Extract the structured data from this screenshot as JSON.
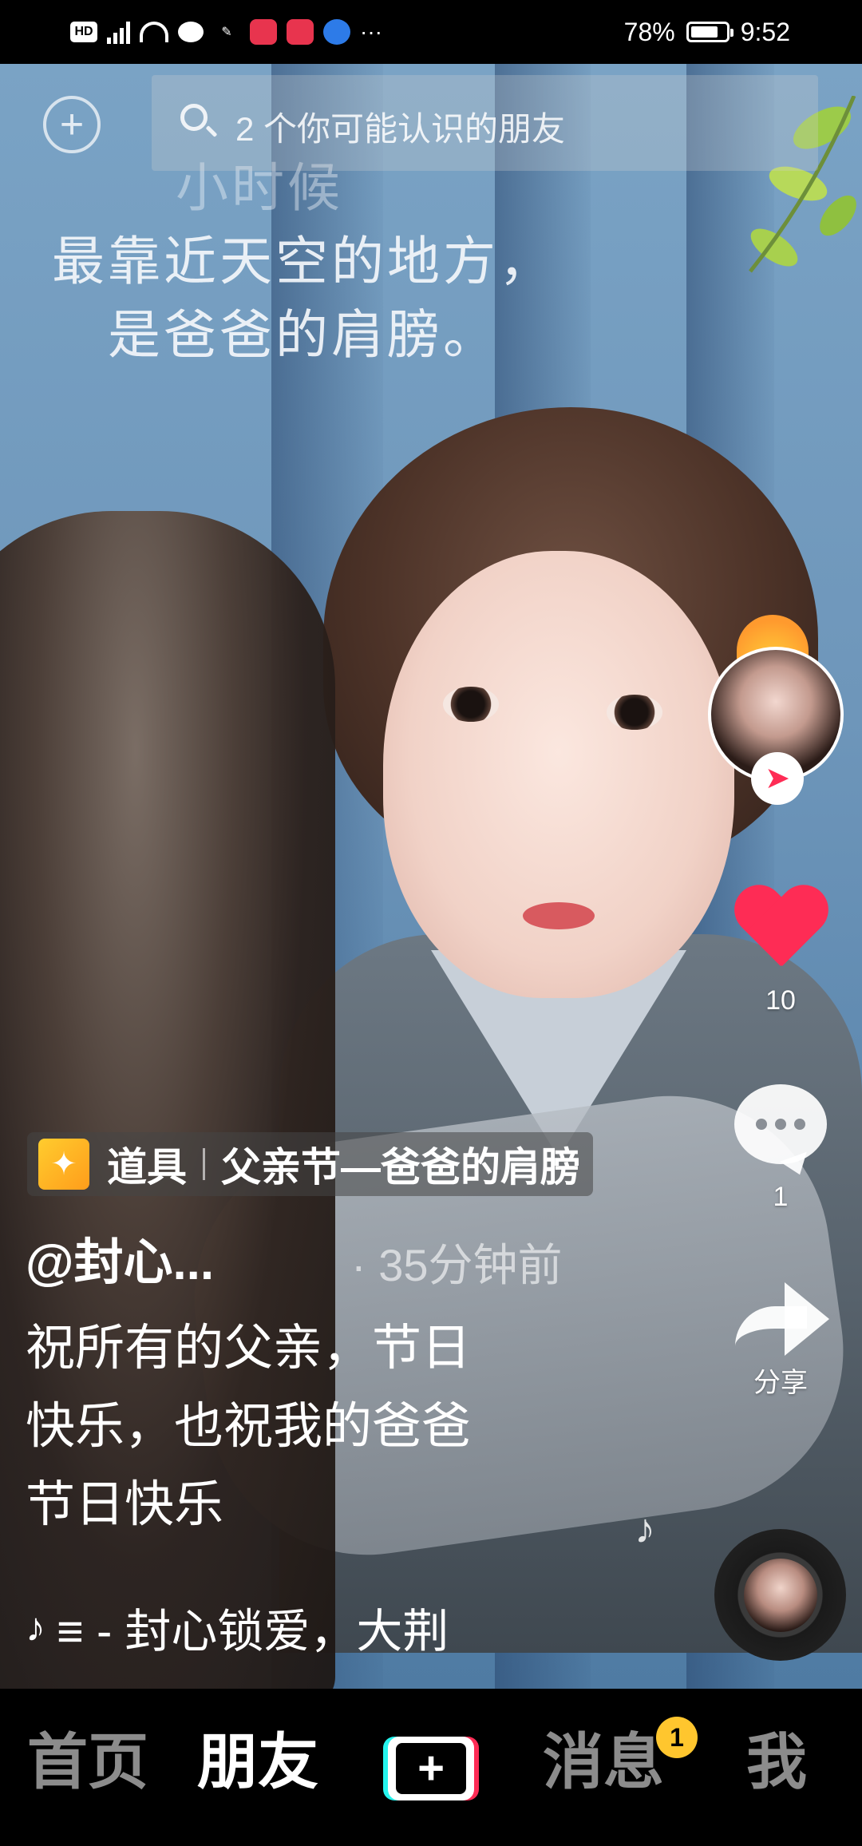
{
  "status_bar": {
    "left_icons": [
      "hd-icon",
      "4g-signal-icon",
      "wifi-icon",
      "wechat-icon",
      "app-icon",
      "huawei-app-icon",
      "huawei-icon",
      "browser-icon"
    ],
    "more": "···",
    "battery": "78%",
    "battery_level": 0.78,
    "time": "9:52"
  },
  "search": {
    "text": "2 个你可能认识的朋友"
  },
  "wall_text": {
    "line1": "小时候",
    "line2": "最靠近天空的地方，",
    "line3": "是爸爸的肩膀。"
  },
  "actions": {
    "likes": "10",
    "comments": "1",
    "share_label": "分享"
  },
  "prop": {
    "label": "道具",
    "name": "父亲节—爸爸的肩膀"
  },
  "post": {
    "author": "@封心...",
    "time_ago": "· 35分钟前",
    "caption_line1": "祝所有的父亲，节日",
    "caption_line2": "快乐，也祝我的爸爸",
    "caption_line3": "节日快乐",
    "music": "≡ - 封心锁爱，大荆"
  },
  "nav": {
    "home": "首页",
    "friends": "朋友",
    "create": "+",
    "messages": "消息",
    "messages_badge": "1",
    "me": "我"
  },
  "colors": {
    "accent": "#fe2c55",
    "badge": "#ffc62e",
    "cyan": "#25f4ee"
  }
}
